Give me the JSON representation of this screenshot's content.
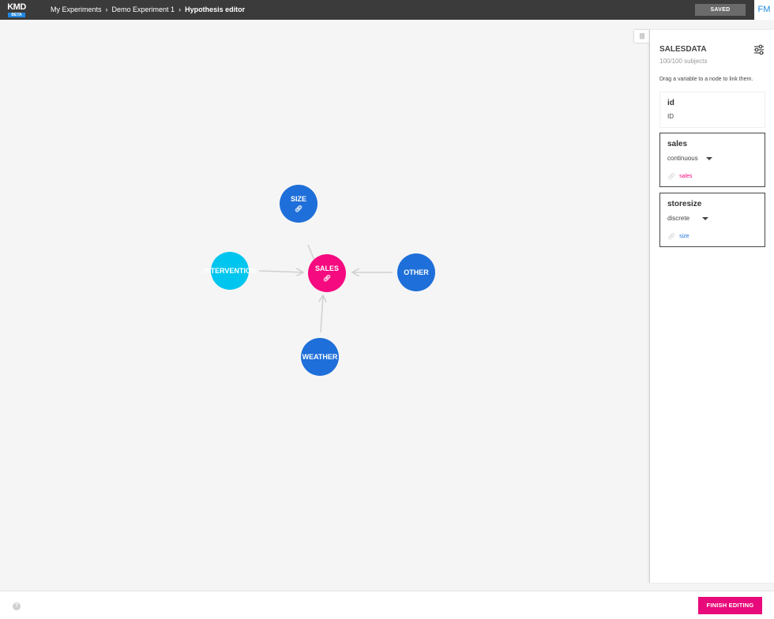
{
  "app": {
    "logo_text": "KMD",
    "logo_badge": "BETA"
  },
  "breadcrumb": [
    "My Experiments",
    "Demo Experiment 1",
    "Hypothesis editor"
  ],
  "breadcrumb_separator": "›",
  "header": {
    "status_label": "SAVED",
    "avatar_initials": "FM"
  },
  "graph": {
    "nodes": [
      {
        "id": "size",
        "label": "SIZE",
        "color": "#1e6fd9",
        "linked": true
      },
      {
        "id": "intervention",
        "label": "INTERVENTION",
        "color": "#00c6ef",
        "linked": false
      },
      {
        "id": "sales",
        "label": "SALES",
        "color": "#f50a7f",
        "linked": true
      },
      {
        "id": "other",
        "label": "OTHER",
        "color": "#1e6fd9",
        "linked": false
      },
      {
        "id": "weather",
        "label": "WEATHER",
        "color": "#1e6fd9",
        "linked": false
      }
    ],
    "edges": [
      {
        "from": "size",
        "to": "sales"
      },
      {
        "from": "intervention",
        "to": "sales"
      },
      {
        "from": "other",
        "to": "sales"
      },
      {
        "from": "weather",
        "to": "sales"
      }
    ],
    "link_icon": "link-icon"
  },
  "panel": {
    "handle": "|||",
    "title": "SALESDATA",
    "subtitle": "100/100 subjects",
    "hint": "Drag a variable to a node to link them.",
    "settings_icon": "sliders-icon",
    "variables": [
      {
        "name": "id",
        "type": "ID"
      },
      {
        "name": "sales",
        "type": "continuous",
        "linked_node": "sales",
        "link_color": "#f50a7f"
      },
      {
        "name": "storesize",
        "type": "discrete",
        "linked_node": "size",
        "link_color": "#1e6fd9"
      }
    ]
  },
  "footer": {
    "help_icon": "?",
    "finish_label": "FINISH EDITING"
  },
  "colors": {
    "accent": "#e8097a",
    "header_bg": "#3b3b3b",
    "canvas_bg": "#f5f5f5"
  }
}
